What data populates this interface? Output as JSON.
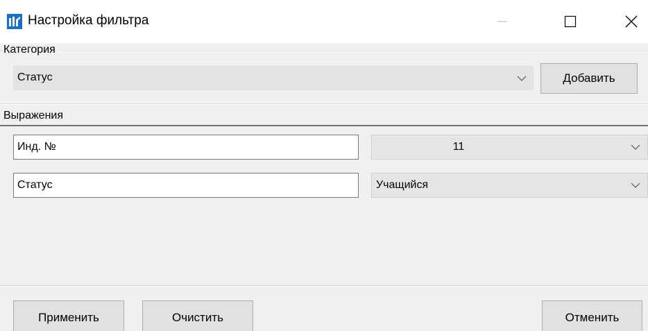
{
  "window": {
    "title": "Настройка фильтра",
    "controls": {
      "minimize_icon": "minimize-icon",
      "maximize_icon": "maximize-icon",
      "close_icon": "close-icon"
    }
  },
  "category": {
    "group_label": "Категория",
    "selected": "Статус",
    "add_button": "Добавить"
  },
  "expressions": {
    "group_label": "Выражения",
    "rows": [
      {
        "field": "Инд. №",
        "value": "11"
      },
      {
        "field": "Статус",
        "value": "Учащийся"
      }
    ]
  },
  "footer": {
    "apply_button": "Применить",
    "clear_button": "Очистить",
    "cancel_button": "Отменить"
  },
  "colors": {
    "window_bg": "#f0f0f0",
    "titlebar_bg": "#ffffff",
    "button_bg": "#e1e1e1",
    "icon_blue": "#1a6fc4"
  }
}
